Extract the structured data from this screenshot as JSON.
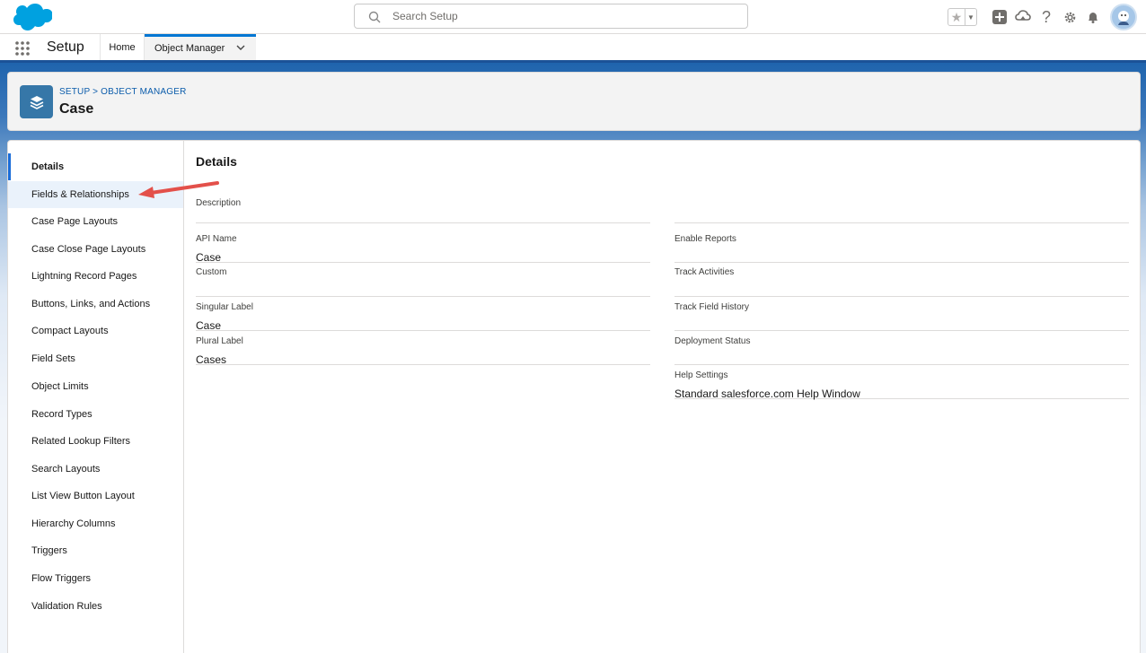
{
  "header": {
    "search_placeholder": "Search Setup"
  },
  "icons": {
    "logo": "salesforce-cloud-logo",
    "favorites": "star-icon",
    "add": "plus-icon",
    "trailhead": "trailhead-icon",
    "help": "question-icon",
    "settings": "gear-icon",
    "notifications": "bell-icon",
    "avatar": "user-avatar"
  },
  "colors": {
    "brand": "#1b5297",
    "accent": "#0176d3",
    "object_icon": "#3677a8",
    "annotation_arrow": "#e3504a"
  },
  "context_nav": {
    "app_name": "Setup",
    "tabs": [
      {
        "label": "Home"
      },
      {
        "label": "Object Manager"
      }
    ]
  },
  "page_header": {
    "breadcrumb": "SETUP > OBJECT MANAGER",
    "title": "Case"
  },
  "sidebar": {
    "items": [
      {
        "label": "Details",
        "state": "active"
      },
      {
        "label": "Fields & Relationships",
        "state": "hover"
      },
      {
        "label": "Case Page Layouts"
      },
      {
        "label": "Case Close Page Layouts"
      },
      {
        "label": "Lightning Record Pages"
      },
      {
        "label": "Buttons, Links, and Actions"
      },
      {
        "label": "Compact Layouts"
      },
      {
        "label": "Field Sets"
      },
      {
        "label": "Object Limits"
      },
      {
        "label": "Record Types"
      },
      {
        "label": "Related Lookup Filters"
      },
      {
        "label": "Search Layouts"
      },
      {
        "label": "List View Button Layout"
      },
      {
        "label": "Hierarchy Columns"
      },
      {
        "label": "Triggers"
      },
      {
        "label": "Flow Triggers"
      },
      {
        "label": "Validation Rules"
      }
    ]
  },
  "details": {
    "title": "Details",
    "description": {
      "label": "Description",
      "value": ""
    },
    "left": [
      {
        "label": "API Name",
        "value": "Case"
      },
      {
        "label": "Custom",
        "value": ""
      },
      {
        "label": "Singular Label",
        "value": "Case"
      },
      {
        "label": "Plural Label",
        "value": "Cases"
      }
    ],
    "right": [
      {
        "label": "Enable Reports",
        "value": ""
      },
      {
        "label": "Track Activities",
        "value": ""
      },
      {
        "label": "Track Field History",
        "value": ""
      },
      {
        "label": "Deployment Status",
        "value": ""
      },
      {
        "label": "Help Settings",
        "value": "Standard salesforce.com Help Window"
      }
    ]
  }
}
